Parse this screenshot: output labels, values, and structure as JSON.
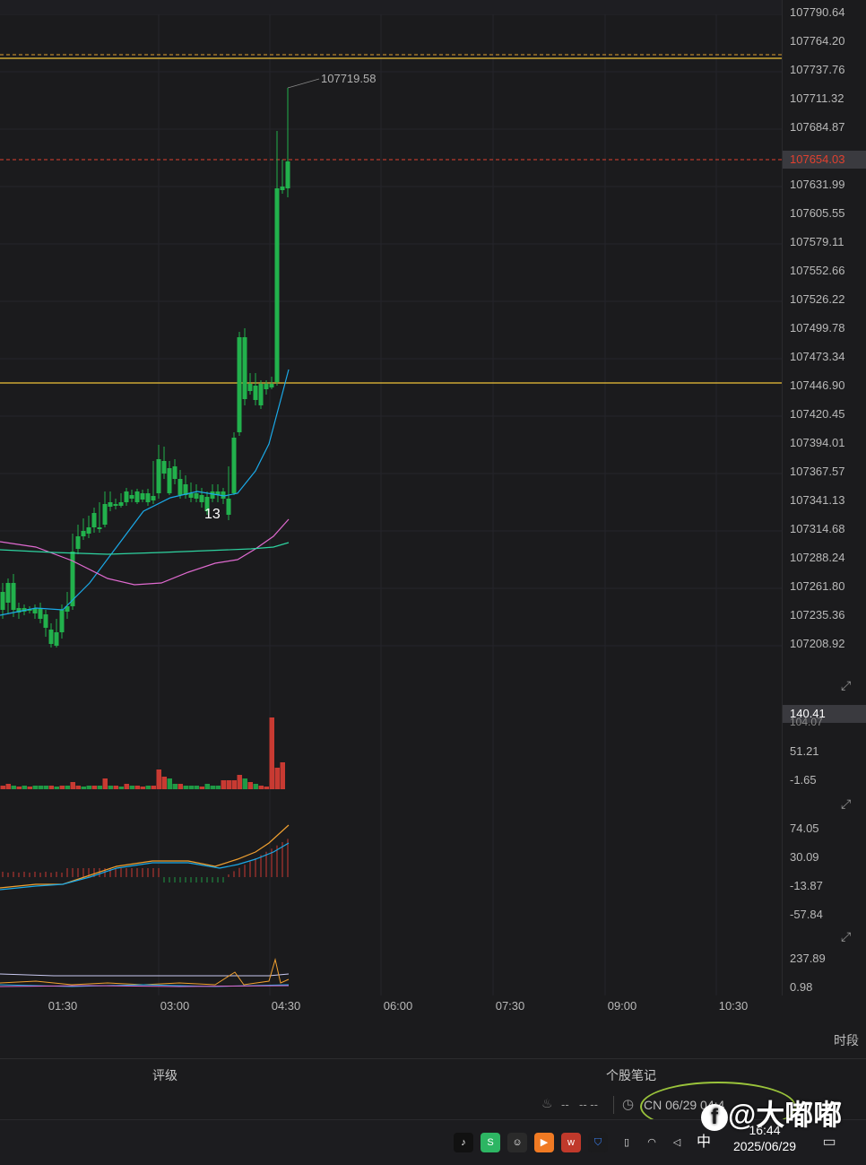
{
  "price_axis": {
    "labels": [
      "107790.64",
      "107764.20",
      "107737.76",
      "107711.32",
      "107684.87",
      "107654.03",
      "107631.99",
      "107605.55",
      "107579.11",
      "107552.66",
      "107526.22",
      "107499.78",
      "107473.34",
      "107446.90",
      "107420.45",
      "107394.01",
      "107367.57",
      "107341.13",
      "107314.68",
      "107288.24",
      "107261.80",
      "107235.36",
      "107208.92"
    ],
    "current_price": "107654.03",
    "high_marker": "107719.58",
    "candle_count_label": "13"
  },
  "volume_axis": {
    "current": "140.41",
    "labels": [
      "104.07",
      "51.21",
      "-1.65"
    ]
  },
  "macd_axis": {
    "labels": [
      "74.05",
      "30.09",
      "-13.87",
      "-57.84"
    ]
  },
  "osc_axis": {
    "labels": [
      "237.89",
      "0.98"
    ]
  },
  "time_axis": {
    "labels": [
      "01:30",
      "03:00",
      "04:30",
      "06:00",
      "07:30",
      "09:00",
      "10:30"
    ]
  },
  "period_label": "时段",
  "bottom_tabs": {
    "rating": "评级",
    "notes": "个股笔记"
  },
  "status_row": {
    "dash1": "--",
    "dash2": "-- --",
    "market_time": "CN 06/29 04:4"
  },
  "taskbar": {
    "time": "16:44",
    "date": "2025/06/29",
    "ime": "中"
  },
  "watermark": "@大嘟嘟",
  "colors": {
    "up": "#e0402f",
    "down": "#22b14c",
    "ma_fast": "#1aa9e8",
    "ma_mid": "#e06ad0",
    "ma_slow": "#2ed3a0",
    "hline": "#f0c23a",
    "price_line": "#e0402f"
  }
}
